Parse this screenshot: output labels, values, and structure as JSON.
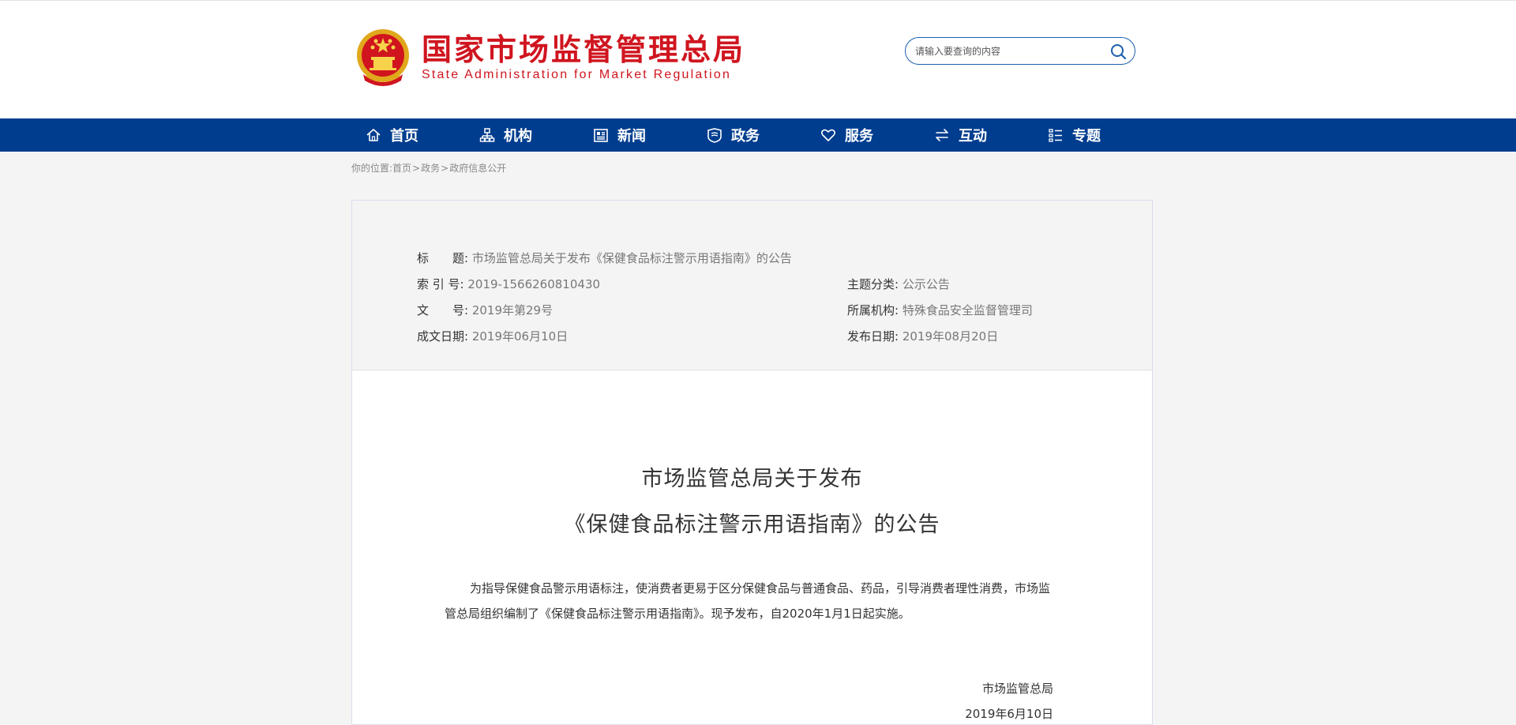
{
  "header": {
    "logo_cn": "国家市场监督管理总局",
    "logo_en": "State Administration for Market Regulation",
    "search_placeholder": "请输入要查询的内容",
    "colors": {
      "brand_red": "#d0151f",
      "nav_blue": "#003d8f"
    }
  },
  "nav": {
    "items": [
      {
        "label": "首页",
        "icon": "home-icon"
      },
      {
        "label": "机构",
        "icon": "org-chart-icon"
      },
      {
        "label": "新闻",
        "icon": "newspaper-icon"
      },
      {
        "label": "政务",
        "icon": "shield-book-icon"
      },
      {
        "label": "服务",
        "icon": "heart-icon"
      },
      {
        "label": "互动",
        "icon": "exchange-arrows-icon"
      },
      {
        "label": "专题",
        "icon": "list-icon"
      }
    ]
  },
  "breadcrumb": {
    "prefix": "你的位置:",
    "items": [
      "首页",
      "政务",
      "政府信息公开"
    ],
    "separator": ">"
  },
  "meta": {
    "title_label": "标　　题:",
    "title_value": "市场监管总局关于发布《保健食品标注警示用语指南》的公告",
    "index_label": "索 引 号:",
    "index_value": "2019-1566260810430",
    "topic_label": "主题分类:",
    "topic_value": "公示公告",
    "docno_label": "文　　号:",
    "docno_value": "2019年第29号",
    "org_label": "所属机构:",
    "org_value": "特殊食品安全监督管理司",
    "created_label": "成文日期:",
    "created_value": "2019年06月10日",
    "published_label": "发布日期:",
    "published_value": "2019年08月20日"
  },
  "document": {
    "title_line1": "市场监管总局关于发布",
    "title_line2": "《保健食品标注警示用语指南》的公告",
    "body": "为指导保健食品警示用语标注，使消费者更易于区分保健食品与普通食品、药品，引导消费者理性消费，市场监管总局组织编制了《保健食品标注警示用语指南》。现予发布，自2020年1月1日起实施。",
    "signer": "市场监管总局",
    "sign_date": "2019年6月10日"
  }
}
